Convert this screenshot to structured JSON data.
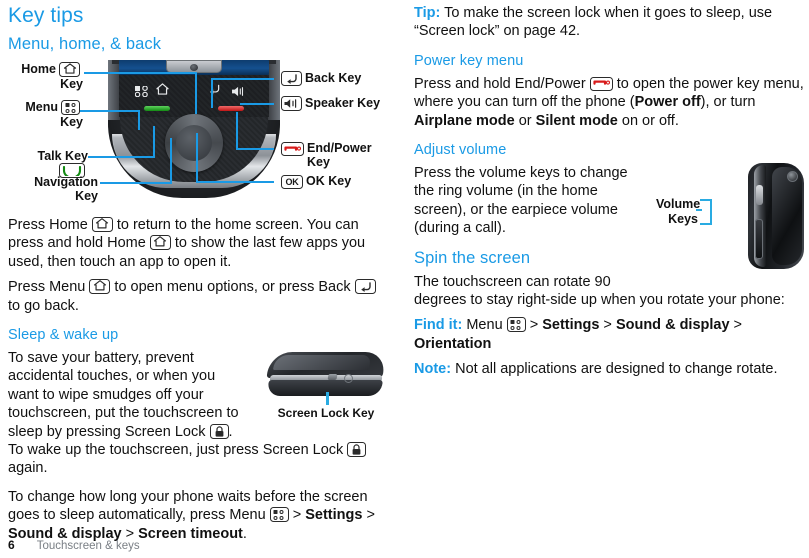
{
  "page": {
    "number": "6",
    "footer_title": "Touchscreen & keys"
  },
  "left_column": {
    "title": "Key tips",
    "section_menu_home_back": {
      "heading": "Menu, home, & back",
      "diagram": {
        "callouts_left": [
          {
            "name": "home-key",
            "line1": "Home",
            "line2": "Key",
            "icon": "home-icon"
          },
          {
            "name": "menu-key",
            "line1": "Menu",
            "line2": "Key",
            "icon": "menu-icon"
          },
          {
            "name": "talk-key",
            "line1": "Talk Key",
            "line2": "",
            "icon": "talk-icon"
          },
          {
            "name": "navigation-key",
            "line1": "Navigation",
            "line2": "Key",
            "icon": ""
          }
        ],
        "callouts_right": [
          {
            "name": "back-key",
            "label": "Back Key",
            "icon": "back-arrow-icon"
          },
          {
            "name": "speaker-key",
            "label": "Speaker Key",
            "icon": "speaker-icon"
          },
          {
            "name": "end-power-key",
            "line1": "End/Power",
            "line2": "Key",
            "icon": "end-power-icon"
          },
          {
            "name": "ok-key",
            "label": "OK Key",
            "icon": "ok-icon"
          }
        ]
      },
      "paragraph_1_a": "Press Home ",
      "paragraph_1_b": " to return to the home screen. You can press and hold Home ",
      "paragraph_1_c": " to show the last few apps you used, then touch an app to open it.",
      "paragraph_2_a": "Press Menu ",
      "paragraph_2_b": " to open menu options, or press Back ",
      "paragraph_2_c": " to go back."
    },
    "section_sleep_wake": {
      "heading": "Sleep & wake up",
      "figure_caption": "Screen Lock Key",
      "paragraph_1_a": "To save your battery, prevent accidental touches, or when you want to wipe smudges off your touchscreen, put the touchscreen to sleep by pressing Screen Lock ",
      "paragraph_1_b": ". To wake up the touchscreen, just press Screen Lock ",
      "paragraph_1_c": " again.",
      "paragraph_2_a": "To change how long your phone waits before the screen goes to sleep automatically, press Menu ",
      "paragraph_2_b": " > ",
      "paragraph_2_path_1": "Settings",
      "paragraph_2_sep_1": " > ",
      "paragraph_2_path_2": "Sound & display",
      "paragraph_2_sep_2": " > ",
      "paragraph_2_path_3": "Screen timeout",
      "paragraph_2_end": "."
    }
  },
  "right_column": {
    "tip": {
      "lead": "Tip:",
      "text": " To make the screen lock when it goes to sleep, use “Screen lock” on page 42."
    },
    "section_power_key_menu": {
      "heading": "Power key menu",
      "paragraph_a": "Press and hold End/Power ",
      "paragraph_b": " to open the power key menu, where you can turn off the phone (",
      "bold_1": "Power off",
      "paragraph_c": "), or turn ",
      "bold_2": "Airplane mode",
      "paragraph_d": " or ",
      "bold_3": "Silent mode",
      "paragraph_e": " on or off."
    },
    "section_adjust_volume": {
      "heading": "Adjust volume",
      "paragraph": "Press the volume keys to change the ring volume (in the home screen), or the earpiece volume (during a call).",
      "figure_label_line1": "Volume",
      "figure_label_line2": "Keys"
    },
    "section_spin_the_screen": {
      "heading": "Spin the screen",
      "paragraph": "The touchscreen can rotate 90 degrees to stay right-side up when you rotate your phone:",
      "find_it_lead": "Find it:",
      "find_it_menu": " Menu ",
      "find_it_sep": " > ",
      "find_it_path_1": "Settings",
      "find_it_path_2": "Sound & display",
      "find_it_path_3": "Orientation",
      "note_lead": "Note:",
      "note_text": " Not all applications are designed to change rotate."
    }
  },
  "colors": {
    "accent_blue": "#1a9ae5",
    "leader_blue": "#29abe2",
    "text": "#111111",
    "footer_gray": "#7a7f85",
    "talk_green": "#138a13",
    "end_red": "#c01515"
  }
}
